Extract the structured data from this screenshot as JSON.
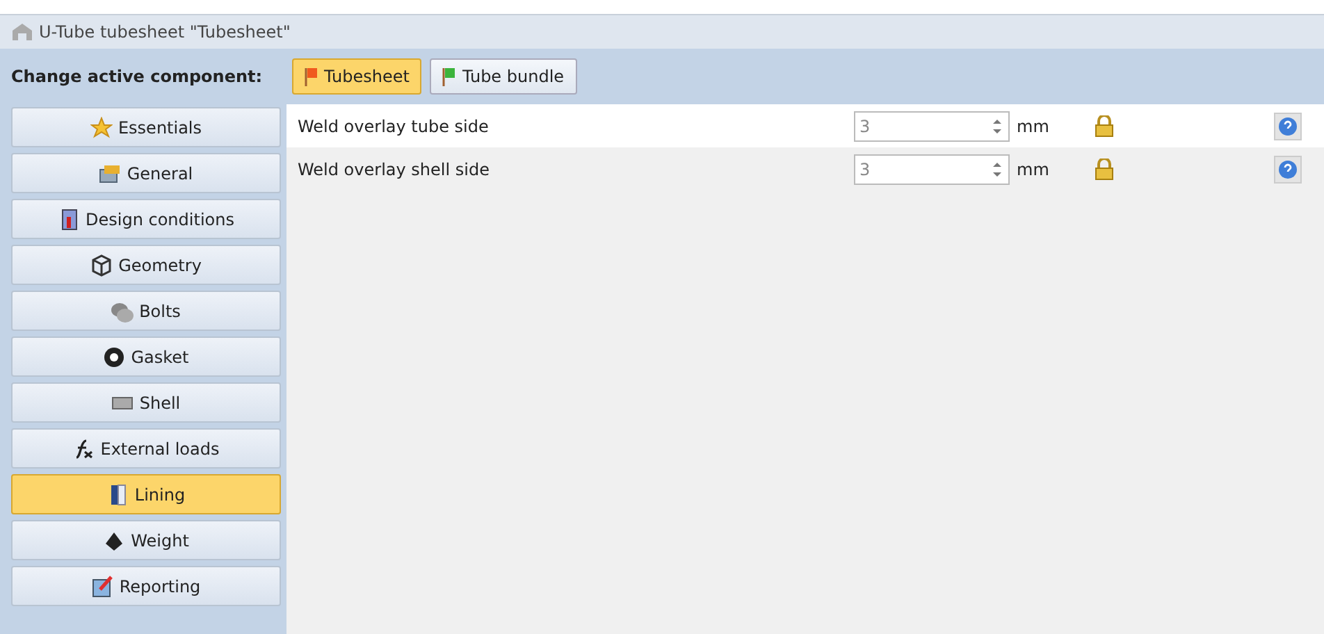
{
  "window": {
    "title": "U-Tube tubesheet \"Tubesheet\""
  },
  "component_bar": {
    "label": "Change active component:",
    "components": [
      {
        "label": "Tubesheet",
        "selected": true,
        "color": "#f05a1e"
      },
      {
        "label": "Tube bundle",
        "selected": false,
        "color": "#3cb43c"
      }
    ]
  },
  "sidebar": {
    "items": [
      {
        "label": "Essentials",
        "selected": false
      },
      {
        "label": "General",
        "selected": false
      },
      {
        "label": "Design conditions",
        "selected": false
      },
      {
        "label": "Geometry",
        "selected": false
      },
      {
        "label": "Bolts",
        "selected": false
      },
      {
        "label": "Gasket",
        "selected": false
      },
      {
        "label": "Shell",
        "selected": false
      },
      {
        "label": "External loads",
        "selected": false
      },
      {
        "label": "Lining",
        "selected": true
      },
      {
        "label": "Weight",
        "selected": false
      },
      {
        "label": "Reporting",
        "selected": false
      }
    ]
  },
  "fields": [
    {
      "label": "Weld overlay tube side",
      "value": "3",
      "unit": "mm"
    },
    {
      "label": "Weld overlay shell side",
      "value": "3",
      "unit": "mm"
    }
  ]
}
